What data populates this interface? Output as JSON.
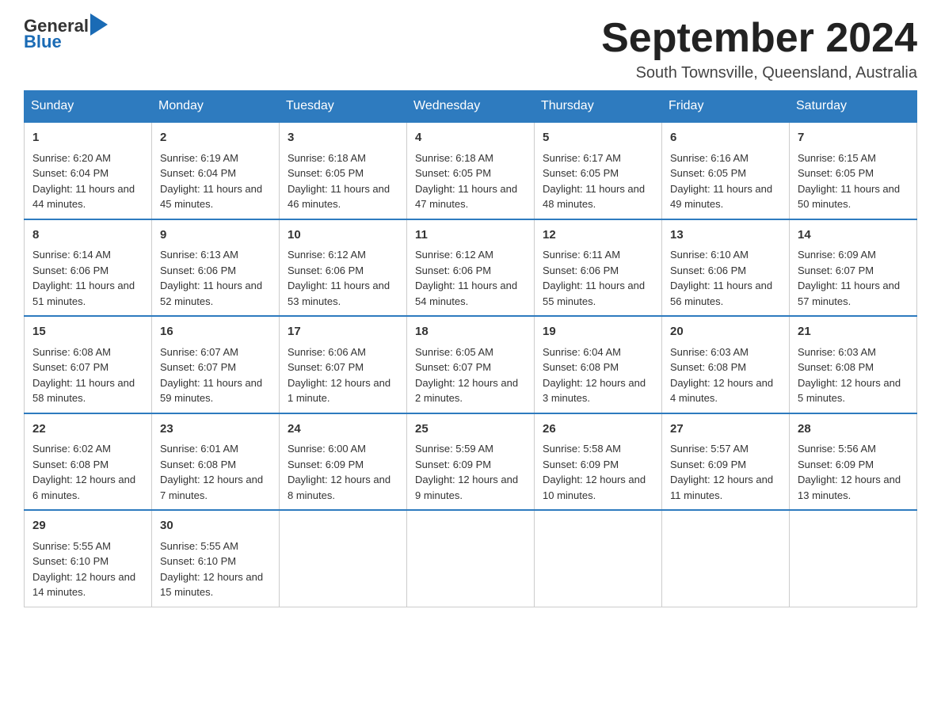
{
  "logo": {
    "general": "General",
    "blue": "Blue"
  },
  "header": {
    "title": "September 2024",
    "subtitle": "South Townsville, Queensland, Australia"
  },
  "days_of_week": [
    "Sunday",
    "Monday",
    "Tuesday",
    "Wednesday",
    "Thursday",
    "Friday",
    "Saturday"
  ],
  "weeks": [
    [
      {
        "day": "1",
        "sunrise": "6:20 AM",
        "sunset": "6:04 PM",
        "daylight": "11 hours and 44 minutes."
      },
      {
        "day": "2",
        "sunrise": "6:19 AM",
        "sunset": "6:04 PM",
        "daylight": "11 hours and 45 minutes."
      },
      {
        "day": "3",
        "sunrise": "6:18 AM",
        "sunset": "6:05 PM",
        "daylight": "11 hours and 46 minutes."
      },
      {
        "day": "4",
        "sunrise": "6:18 AM",
        "sunset": "6:05 PM",
        "daylight": "11 hours and 47 minutes."
      },
      {
        "day": "5",
        "sunrise": "6:17 AM",
        "sunset": "6:05 PM",
        "daylight": "11 hours and 48 minutes."
      },
      {
        "day": "6",
        "sunrise": "6:16 AM",
        "sunset": "6:05 PM",
        "daylight": "11 hours and 49 minutes."
      },
      {
        "day": "7",
        "sunrise": "6:15 AM",
        "sunset": "6:05 PM",
        "daylight": "11 hours and 50 minutes."
      }
    ],
    [
      {
        "day": "8",
        "sunrise": "6:14 AM",
        "sunset": "6:06 PM",
        "daylight": "11 hours and 51 minutes."
      },
      {
        "day": "9",
        "sunrise": "6:13 AM",
        "sunset": "6:06 PM",
        "daylight": "11 hours and 52 minutes."
      },
      {
        "day": "10",
        "sunrise": "6:12 AM",
        "sunset": "6:06 PM",
        "daylight": "11 hours and 53 minutes."
      },
      {
        "day": "11",
        "sunrise": "6:12 AM",
        "sunset": "6:06 PM",
        "daylight": "11 hours and 54 minutes."
      },
      {
        "day": "12",
        "sunrise": "6:11 AM",
        "sunset": "6:06 PM",
        "daylight": "11 hours and 55 minutes."
      },
      {
        "day": "13",
        "sunrise": "6:10 AM",
        "sunset": "6:06 PM",
        "daylight": "11 hours and 56 minutes."
      },
      {
        "day": "14",
        "sunrise": "6:09 AM",
        "sunset": "6:07 PM",
        "daylight": "11 hours and 57 minutes."
      }
    ],
    [
      {
        "day": "15",
        "sunrise": "6:08 AM",
        "sunset": "6:07 PM",
        "daylight": "11 hours and 58 minutes."
      },
      {
        "day": "16",
        "sunrise": "6:07 AM",
        "sunset": "6:07 PM",
        "daylight": "11 hours and 59 minutes."
      },
      {
        "day": "17",
        "sunrise": "6:06 AM",
        "sunset": "6:07 PM",
        "daylight": "12 hours and 1 minute."
      },
      {
        "day": "18",
        "sunrise": "6:05 AM",
        "sunset": "6:07 PM",
        "daylight": "12 hours and 2 minutes."
      },
      {
        "day": "19",
        "sunrise": "6:04 AM",
        "sunset": "6:08 PM",
        "daylight": "12 hours and 3 minutes."
      },
      {
        "day": "20",
        "sunrise": "6:03 AM",
        "sunset": "6:08 PM",
        "daylight": "12 hours and 4 minutes."
      },
      {
        "day": "21",
        "sunrise": "6:03 AM",
        "sunset": "6:08 PM",
        "daylight": "12 hours and 5 minutes."
      }
    ],
    [
      {
        "day": "22",
        "sunrise": "6:02 AM",
        "sunset": "6:08 PM",
        "daylight": "12 hours and 6 minutes."
      },
      {
        "day": "23",
        "sunrise": "6:01 AM",
        "sunset": "6:08 PM",
        "daylight": "12 hours and 7 minutes."
      },
      {
        "day": "24",
        "sunrise": "6:00 AM",
        "sunset": "6:09 PM",
        "daylight": "12 hours and 8 minutes."
      },
      {
        "day": "25",
        "sunrise": "5:59 AM",
        "sunset": "6:09 PM",
        "daylight": "12 hours and 9 minutes."
      },
      {
        "day": "26",
        "sunrise": "5:58 AM",
        "sunset": "6:09 PM",
        "daylight": "12 hours and 10 minutes."
      },
      {
        "day": "27",
        "sunrise": "5:57 AM",
        "sunset": "6:09 PM",
        "daylight": "12 hours and 11 minutes."
      },
      {
        "day": "28",
        "sunrise": "5:56 AM",
        "sunset": "6:09 PM",
        "daylight": "12 hours and 13 minutes."
      }
    ],
    [
      {
        "day": "29",
        "sunrise": "5:55 AM",
        "sunset": "6:10 PM",
        "daylight": "12 hours and 14 minutes."
      },
      {
        "day": "30",
        "sunrise": "5:55 AM",
        "sunset": "6:10 PM",
        "daylight": "12 hours and 15 minutes."
      },
      null,
      null,
      null,
      null,
      null
    ]
  ],
  "labels": {
    "sunrise": "Sunrise:",
    "sunset": "Sunset:",
    "daylight": "Daylight:"
  }
}
